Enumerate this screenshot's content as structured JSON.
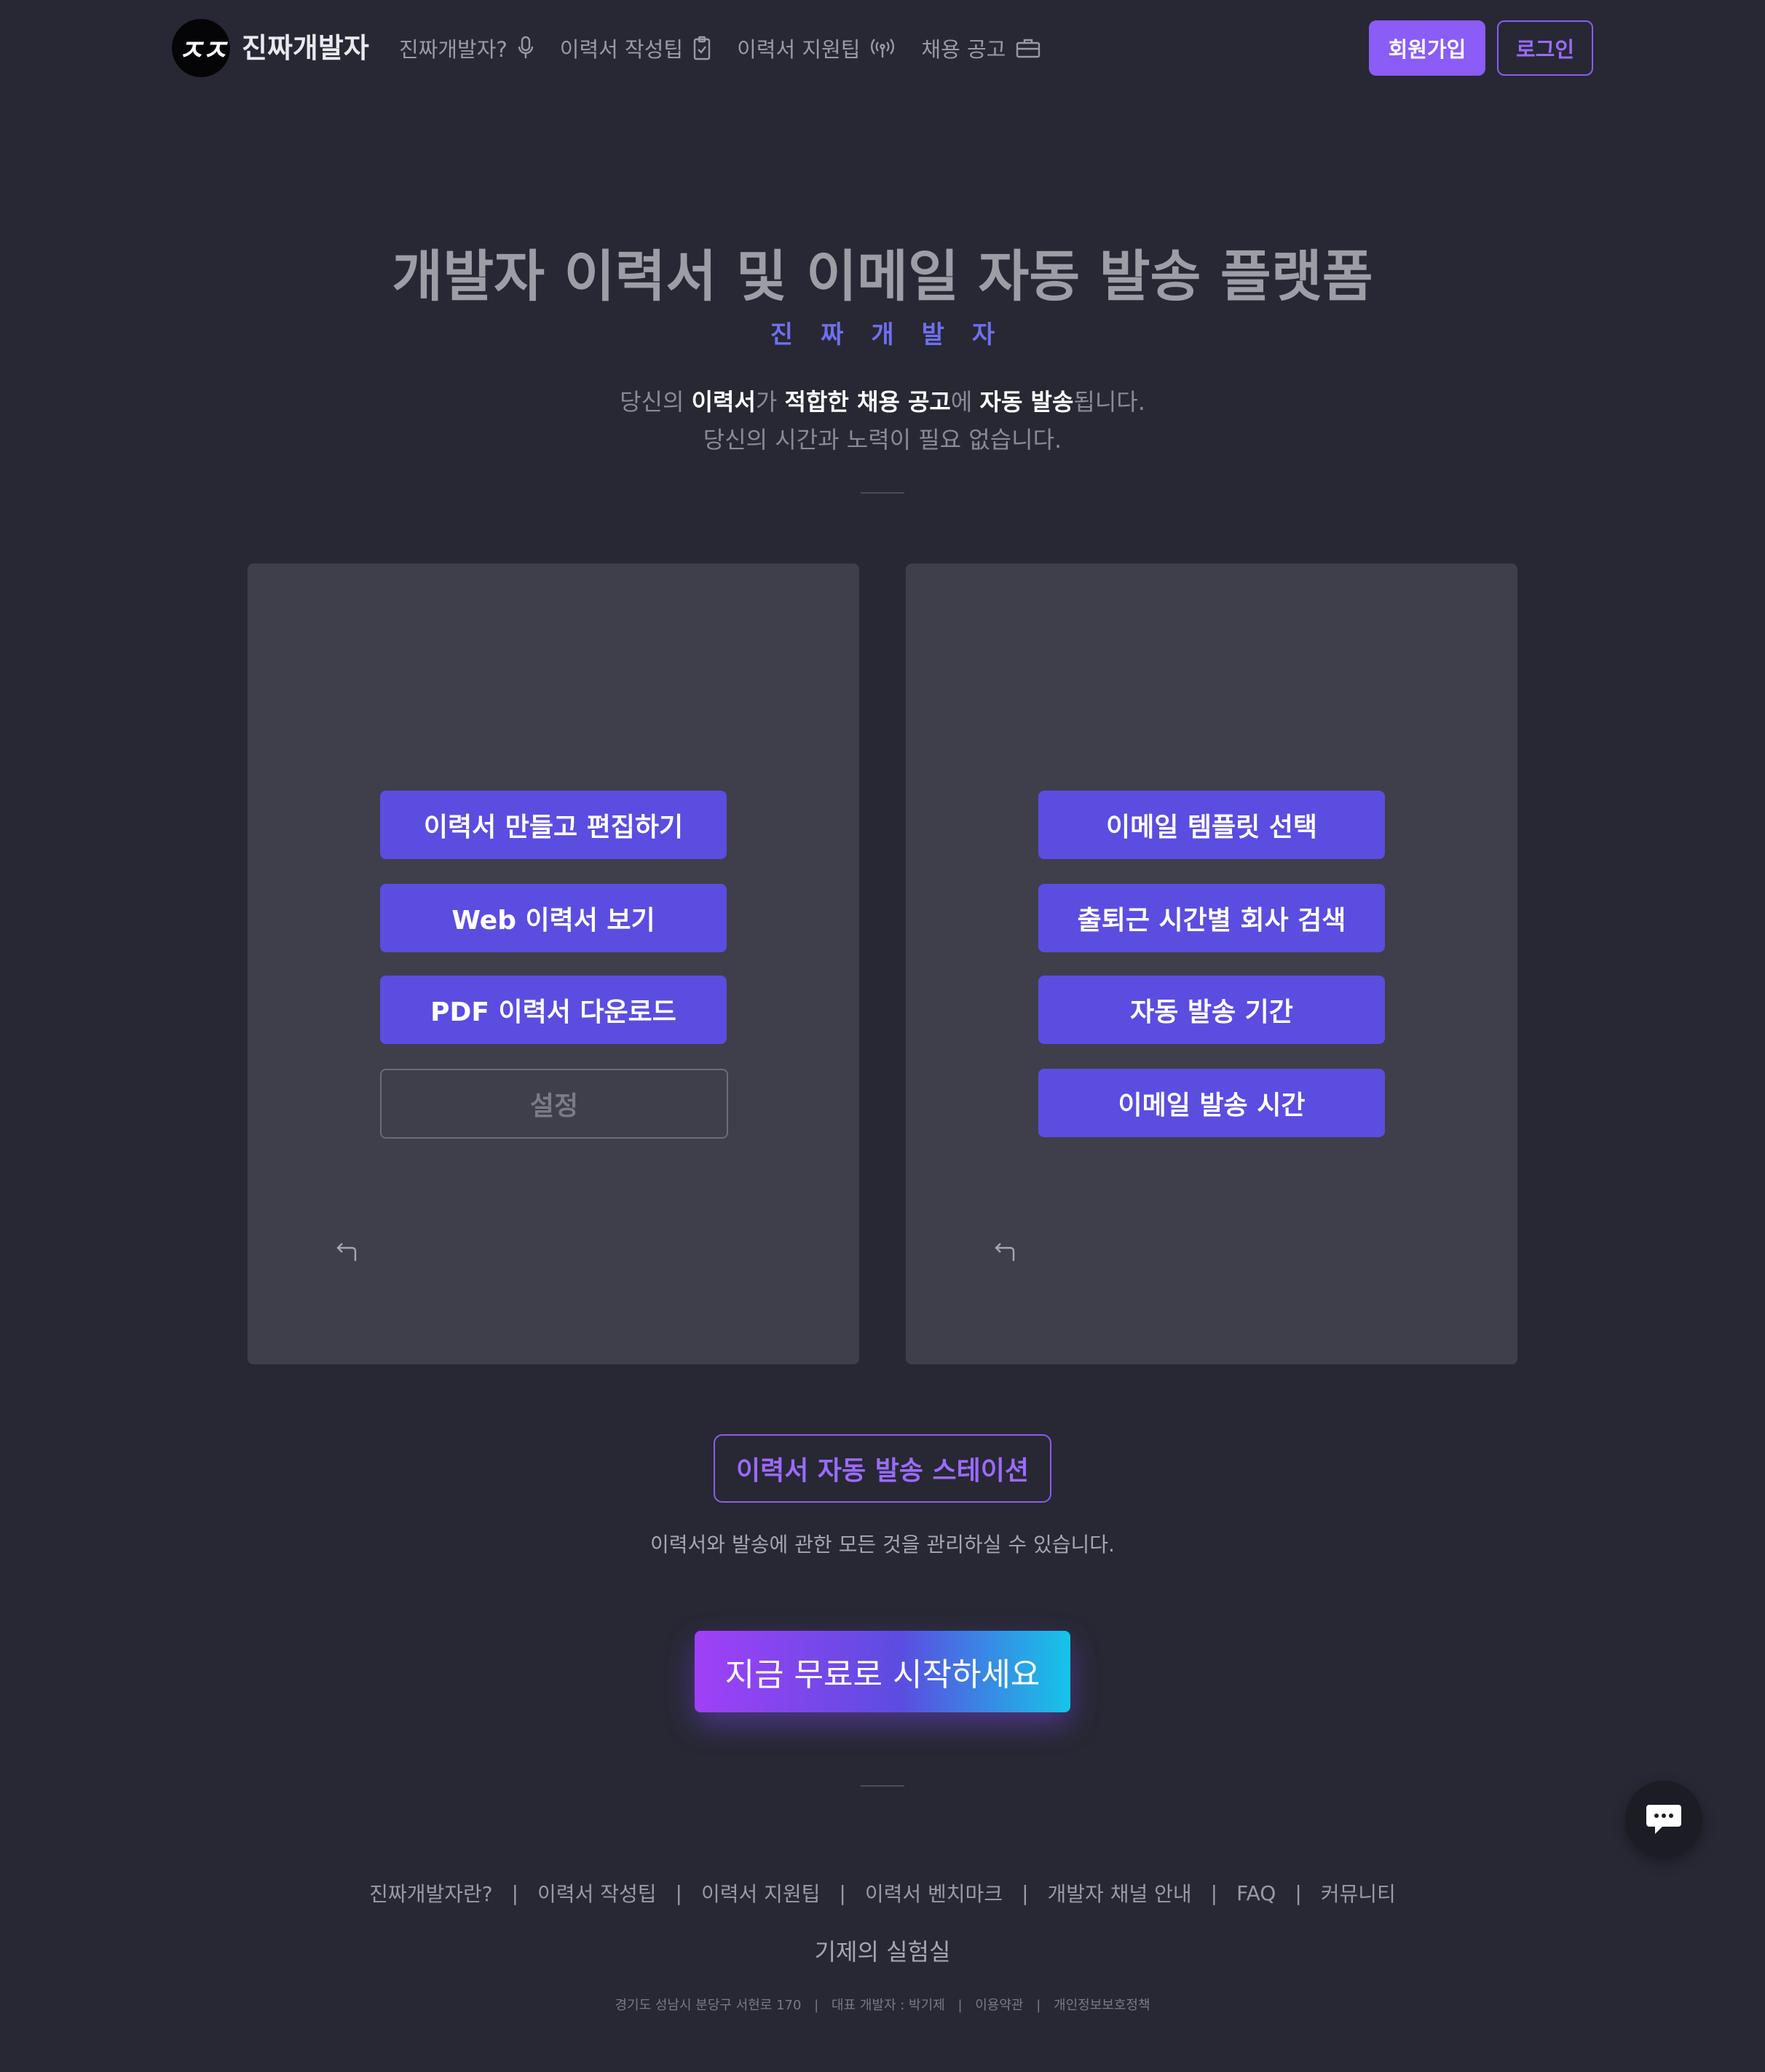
{
  "header": {
    "logo_text": "ㅈㅈ",
    "brand": "진짜개발자",
    "nav": [
      {
        "label": "진짜개발자?",
        "icon": "microphone-icon"
      },
      {
        "label": "이력서 작성팁",
        "icon": "clipboard-icon"
      },
      {
        "label": "이력서 지원팁",
        "icon": "broadcast-icon"
      },
      {
        "label": "채용 공고",
        "icon": "briefcase-icon"
      }
    ],
    "signup_label": "회원가입",
    "login_label": "로그인"
  },
  "hero": {
    "title": "개발자 이력서 및 이메일 자동 발송 플랫폼",
    "subtitle": "진짜개발자",
    "desc_line1": {
      "p1": "당신의 ",
      "b1": "이력서",
      "p2": "가 ",
      "b2": "적합한 채용 공고",
      "p3": "에 ",
      "b3": "자동 발송",
      "p4": "됩니다."
    },
    "desc_line2": "당신의 시간과 노력이 필요 없습니다."
  },
  "left_panel": {
    "buttons": [
      "이력서 만들고 편집하기",
      "Web 이력서 보기",
      "PDF 이력서 다운로드"
    ],
    "settings_label": "설정"
  },
  "right_panel": {
    "buttons": [
      "이메일 템플릿 선택",
      "출퇴근 시간별 회사 검색",
      "자동 발송 기간",
      "이메일 발송 시간"
    ]
  },
  "station": {
    "label": "이력서 자동 발송 스테이션",
    "desc": "이력서와 발송에 관한 모든 것을 관리하실 수 있습니다."
  },
  "cta": {
    "label": "지금 무료로 시작하세요"
  },
  "footer": {
    "links": [
      "진짜개발자란?",
      "이력서 작성팁",
      "이력서 지원팁",
      "이력서 벤치마크",
      "개발자 채널 안내",
      "FAQ",
      "커뮤니티"
    ],
    "separator": "|",
    "brand": "기제의 실험실",
    "info": [
      "경기도 성남시 분당구 서현로 170",
      "대표 개발자 : 박기제",
      "이용약관",
      "개인정보보호정책"
    ]
  },
  "colors": {
    "background": "#272833",
    "panel": "#3e3f4b",
    "primary_button": "#5b4de0",
    "accent_purple": "#8b5cf6",
    "subtitle_blue": "#6f6ff0"
  }
}
